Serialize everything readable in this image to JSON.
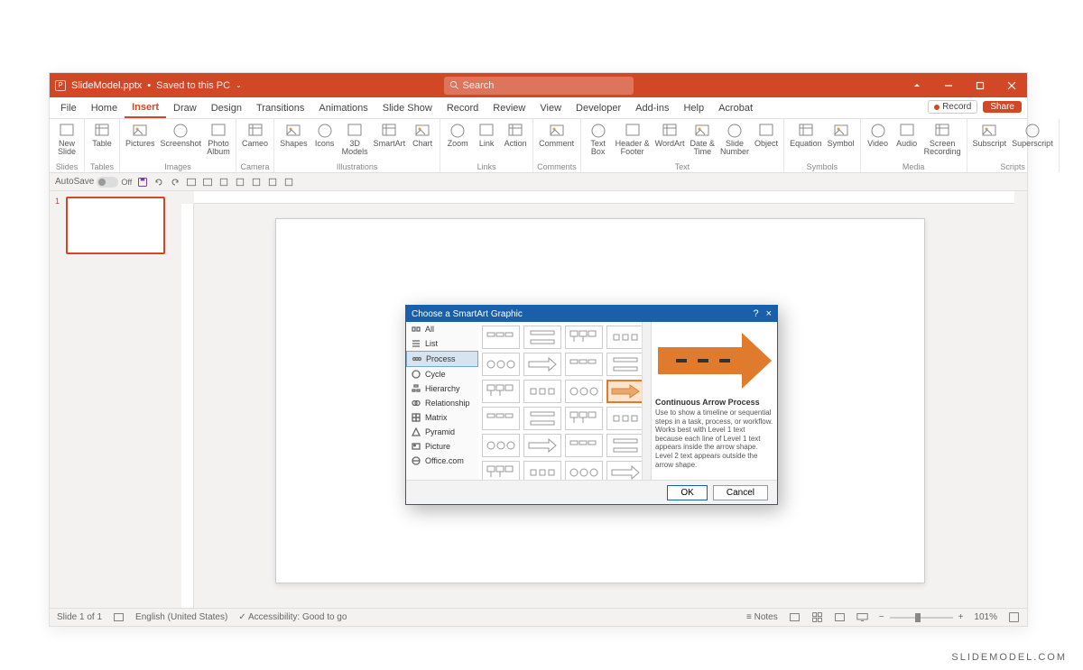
{
  "titlebar": {
    "docname": "SlideModel.pptx",
    "saved": "Saved to this PC",
    "search_placeholder": "Search"
  },
  "window_buttons": {
    "min": "Minimize",
    "max": "Restore",
    "close": "Close"
  },
  "menu": {
    "tabs": [
      "File",
      "Home",
      "Insert",
      "Draw",
      "Design",
      "Transitions",
      "Animations",
      "Slide Show",
      "Record",
      "Review",
      "View",
      "Developer",
      "Add-ins",
      "Help",
      "Acrobat"
    ],
    "active": "Insert",
    "record": "Record",
    "share": "Share"
  },
  "ribbon": {
    "groups": [
      {
        "name": "Slides",
        "items": [
          {
            "label": "New\nSlide"
          }
        ]
      },
      {
        "name": "Tables",
        "items": [
          {
            "label": "Table"
          }
        ]
      },
      {
        "name": "Images",
        "items": [
          {
            "label": "Pictures"
          },
          {
            "label": "Screenshot"
          },
          {
            "label": "Photo\nAlbum"
          }
        ]
      },
      {
        "name": "Camera",
        "items": [
          {
            "label": "Cameo"
          }
        ]
      },
      {
        "name": "Illustrations",
        "items": [
          {
            "label": "Shapes"
          },
          {
            "label": "Icons"
          },
          {
            "label": "3D\nModels"
          },
          {
            "label": "SmartArt"
          },
          {
            "label": "Chart"
          }
        ]
      },
      {
        "name": "Links",
        "items": [
          {
            "label": "Zoom"
          },
          {
            "label": "Link"
          },
          {
            "label": "Action"
          }
        ]
      },
      {
        "name": "Comments",
        "items": [
          {
            "label": "Comment"
          }
        ]
      },
      {
        "name": "Text",
        "items": [
          {
            "label": "Text\nBox"
          },
          {
            "label": "Header &\nFooter"
          },
          {
            "label": "WordArt"
          },
          {
            "label": "Date &\nTime"
          },
          {
            "label": "Slide\nNumber"
          },
          {
            "label": "Object"
          }
        ]
      },
      {
        "name": "Symbols",
        "items": [
          {
            "label": "Equation"
          },
          {
            "label": "Symbol"
          }
        ]
      },
      {
        "name": "Media",
        "items": [
          {
            "label": "Video"
          },
          {
            "label": "Audio"
          },
          {
            "label": "Screen\nRecording"
          }
        ]
      },
      {
        "name": "Scripts",
        "items": [
          {
            "label": "Subscript"
          },
          {
            "label": "Superscript"
          }
        ]
      }
    ]
  },
  "qat": {
    "autosave_label": "AutoSave",
    "autosave": "Off"
  },
  "thumbs": {
    "number": "1"
  },
  "status": {
    "slide": "Slide 1 of 1",
    "lang": "English (United States)",
    "access": "Accessibility: Good to go",
    "notes": "Notes",
    "zoom": "101%"
  },
  "dialog": {
    "title": "Choose a SmartArt Graphic",
    "help": "?",
    "close": "×",
    "categories": [
      "All",
      "List",
      "Process",
      "Cycle",
      "Hierarchy",
      "Relationship",
      "Matrix",
      "Pyramid",
      "Picture",
      "Office.com"
    ],
    "selected_category": "Process",
    "preview_title": "Continuous Arrow Process",
    "preview_desc": "Use to show a timeline or sequential steps in a task, process, or workflow. Works best with Level 1 text because each line of Level 1 text appears inside the arrow shape. Level 2 text appears outside the arrow shape.",
    "ok": "OK",
    "cancel": "Cancel"
  },
  "watermark": "SLIDEMODEL.COM"
}
